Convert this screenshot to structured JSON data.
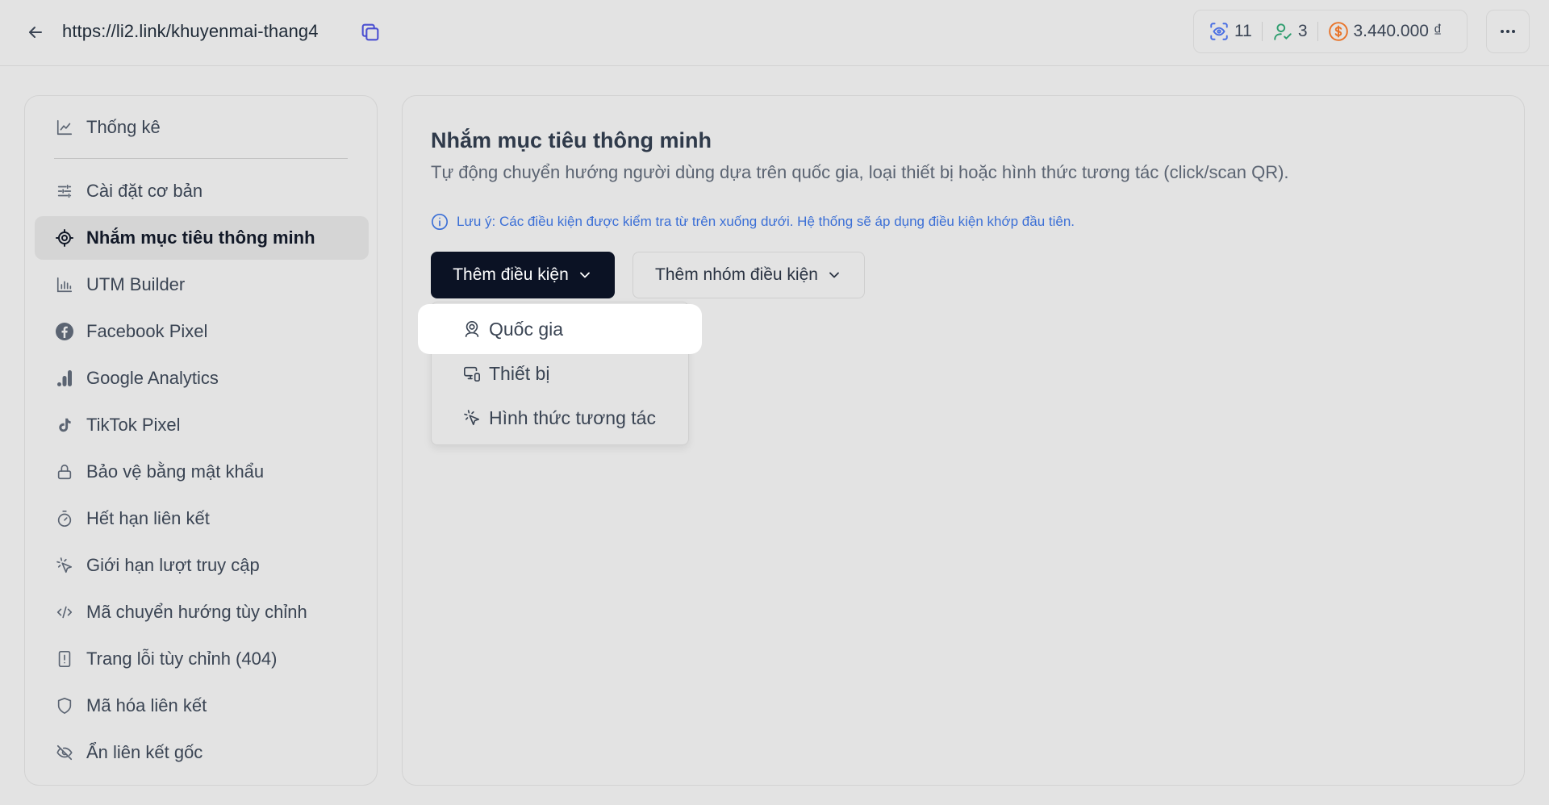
{
  "header": {
    "url": "https://li2.link/khuyenmai-thang4",
    "views": "11",
    "users": "3",
    "revenue": "3.440.000 ₫"
  },
  "sidebar": {
    "items": [
      {
        "label": "Thống kê",
        "icon": "chart-icon"
      },
      {
        "label": "Cài đặt cơ bản",
        "icon": "sliders-icon"
      },
      {
        "label": "Nhắm mục tiêu thông minh",
        "icon": "target-icon",
        "active": true
      },
      {
        "label": "UTM Builder",
        "icon": "bar-chart-icon"
      },
      {
        "label": "Facebook Pixel",
        "icon": "facebook-icon"
      },
      {
        "label": "Google Analytics",
        "icon": "analytics-icon"
      },
      {
        "label": "TikTok Pixel",
        "icon": "tiktok-icon"
      },
      {
        "label": "Bảo vệ bằng mật khẩu",
        "icon": "lock-icon"
      },
      {
        "label": "Hết hạn liên kết",
        "icon": "timer-icon"
      },
      {
        "label": "Giới hạn lượt truy cập",
        "icon": "pointer-click-icon"
      },
      {
        "label": "Mã chuyển hướng tùy chỉnh",
        "icon": "code-icon"
      },
      {
        "label": "Trang lỗi tùy chỉnh (404)",
        "icon": "file-warning-icon"
      },
      {
        "label": "Mã hóa liên kết",
        "icon": "shield-icon"
      },
      {
        "label": "Ẩn liên kết gốc",
        "icon": "eye-off-icon"
      }
    ]
  },
  "main": {
    "title": "Nhắm mục tiêu thông minh",
    "description": "Tự động chuyển hướng người dùng dựa trên quốc gia, loại thiết bị hoặc hình thức tương tác (click/scan QR).",
    "note": "Lưu ý: Các điều kiện được kiểm tra từ trên xuống dưới. Hệ thống sẽ áp dụng điều kiện khớp đầu tiên.",
    "add_condition_label": "Thêm điều kiện",
    "add_group_label": "Thêm nhóm điều kiện"
  },
  "dropdown": {
    "items": [
      {
        "label": "Quốc gia",
        "icon": "map-pin-user-icon"
      },
      {
        "label": "Thiết bị",
        "icon": "devices-icon"
      },
      {
        "label": "Hình thức tương tác",
        "icon": "pointer-click-icon"
      }
    ]
  },
  "colors": {
    "background": "#e3e3e3",
    "primary_button": "#0b1224",
    "note_blue": "#3b6fd6",
    "views_icon": "#4a6fe3",
    "users_icon": "#2f9e6f",
    "revenue_icon": "#e8742a"
  }
}
